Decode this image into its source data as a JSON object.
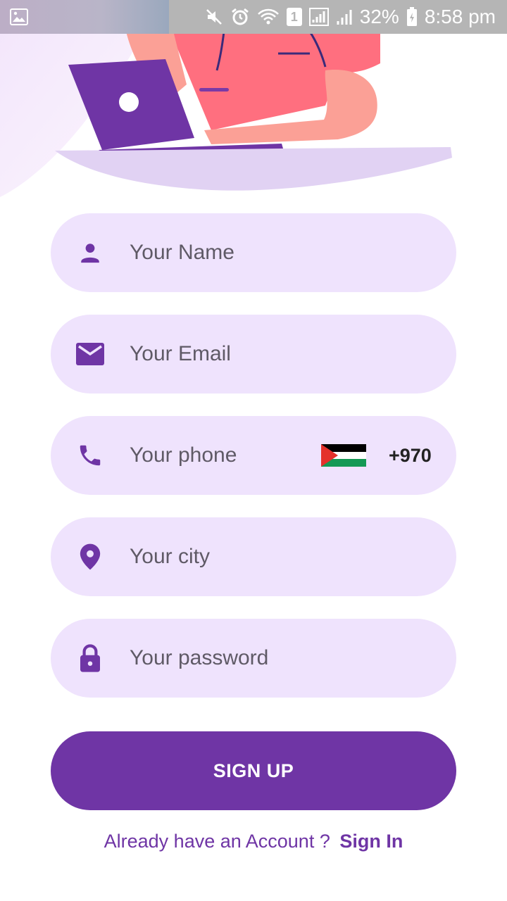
{
  "status_bar": {
    "battery": "32%",
    "time": "8:58 pm",
    "sim_slot": "1",
    "icons": [
      "image-icon",
      "mute-icon",
      "alarm-icon",
      "wifi-icon",
      "sim-icon",
      "signal-icon",
      "signal-icon-2",
      "battery-icon"
    ]
  },
  "form": {
    "name": {
      "placeholder": "Your Name",
      "icon": "person-icon"
    },
    "email": {
      "placeholder": "Your Email",
      "icon": "mail-icon"
    },
    "phone": {
      "placeholder": "Your phone",
      "icon": "phone-icon",
      "country_flag": "palestine-flag-icon",
      "dial_code": "+970"
    },
    "city": {
      "placeholder": "Your city",
      "icon": "location-pin-icon"
    },
    "password": {
      "placeholder": "Your password",
      "icon": "lock-icon"
    }
  },
  "signup_button": {
    "label": "SIGN UP"
  },
  "footer": {
    "prompt": "Already have an Account ?",
    "link": "Sign In"
  },
  "colors": {
    "primary": "#6f35a5",
    "field_bg": "#efe3fd",
    "placeholder_text": "#5f5a66"
  }
}
